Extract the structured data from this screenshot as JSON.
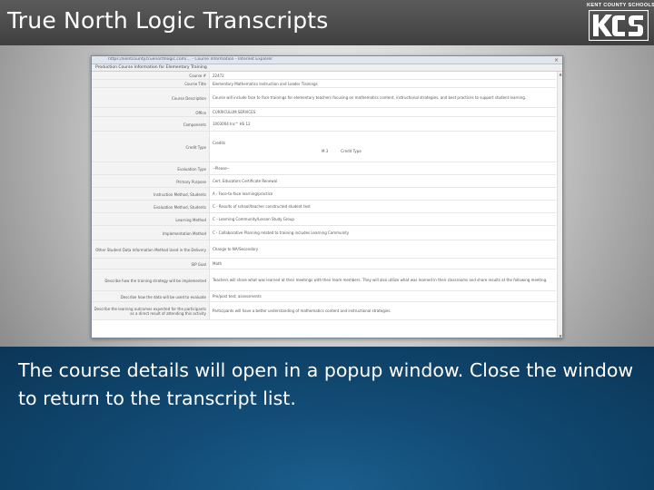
{
  "slide": {
    "title": "True North Logic Transcripts",
    "caption": "The course details will open in a popup window. Close the window to return to the transcript list."
  },
  "logo": {
    "text": "KENT COUNTY SCHOOLS",
    "letters": "KCS"
  },
  "popup": {
    "address": "https://kentcounty.truenorthlogic.com/... - Course Information - Internet Explorer",
    "close_glyph": "×",
    "header": "Production Course Information for Elementary Training",
    "rows": [
      {
        "label": "Course #",
        "value": "22472"
      },
      {
        "label": "Course Title",
        "value": "Elementary Mathematics Instruction and Leader Trainings"
      },
      {
        "label": "Course Description",
        "value": "Course will include face to face trainings for elementary teachers focusing on mathematics content, instructional strategies, and best practices to support student learning."
      },
      {
        "label": "Office",
        "value": "CURRICULUM SERVICES"
      },
      {
        "label": "Components",
        "value": "1003004 Inc^ HS 12"
      },
      {
        "label": "Credit Type",
        "value": "Credits",
        "sub1": "M.3",
        "sub2": "Credit Type"
      },
      {
        "label": "Evaluation Type",
        "value": "--Please--"
      },
      {
        "label": "Primary Purpose",
        "value": "Cert. Educators Certificate Renewal"
      },
      {
        "label": "Instruction Method, Students",
        "value": "A - Face-to-face learning/practice"
      },
      {
        "label": "Evaluation Method, Students",
        "value": "C - Results of school/teacher constructed student test"
      },
      {
        "label": "Learning Method",
        "value": "C - Learning Community/Lesson Study Group"
      },
      {
        "label": "Implementation Method",
        "value": "C - Collaborative Planning related to training includes Learning Community"
      },
      {
        "label": "Other Student Data Information Method Used in the Delivery",
        "value": "Change to NA/Secondary"
      },
      {
        "label": "SIP Goal",
        "value": "Math"
      },
      {
        "label": "Describe how the training strategy will be implemented",
        "value": "Teachers will share what was learned at their meetings with their team members. They will also utilize what was learned in their classrooms and share results at the following meeting."
      },
      {
        "label": "Describe how the data will be used to evaluate",
        "value": "Pre/post test; assessments"
      },
      {
        "label": "Describe the learning outcomes expected for the participants as a direct result of attending this activity",
        "value": "Participants will have a better understanding of mathematics content and instructional strategies."
      }
    ]
  }
}
